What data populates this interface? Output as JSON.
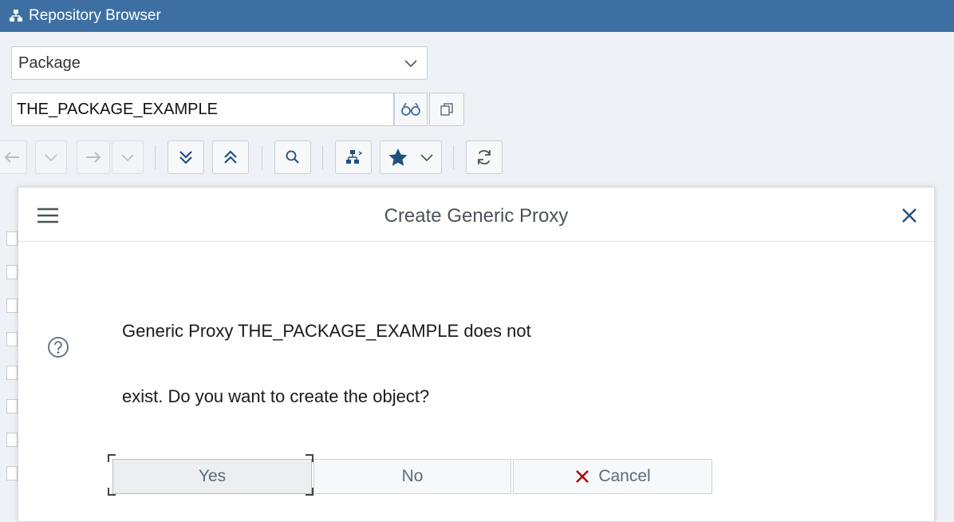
{
  "window": {
    "title": "Repository Browser",
    "icon": "hierarchy-icon",
    "accent_color": "#3d6fa3"
  },
  "object_type_select": {
    "value": "Package",
    "icon": "chevron-down-icon"
  },
  "object_name_input": {
    "value": "THE_PACKAGE_EXAMPLE",
    "buttons": [
      "display-icon",
      "copy-icon"
    ]
  },
  "toolbar": {
    "icons": [
      "back-arrow-icon",
      "back-history-dropdown-icon",
      "forward-arrow-icon",
      "forward-history-dropdown-icon",
      "expand-all-icon",
      "collapse-all-icon",
      "search-icon",
      "hierarchy-icon",
      "favorites-star-icon",
      "refresh-icon"
    ]
  },
  "dialog": {
    "title": "Create Generic Proxy",
    "message_line1": "Generic Proxy THE_PACKAGE_EXAMPLE does not",
    "message_line2": "exist. Do you want to create the object?",
    "icons": [
      "menu-icon",
      "close-icon",
      "help-icon"
    ],
    "buttons": {
      "yes": "Yes",
      "no": "No",
      "cancel": "Cancel"
    },
    "cancel_icon_color": "#bb0000"
  }
}
